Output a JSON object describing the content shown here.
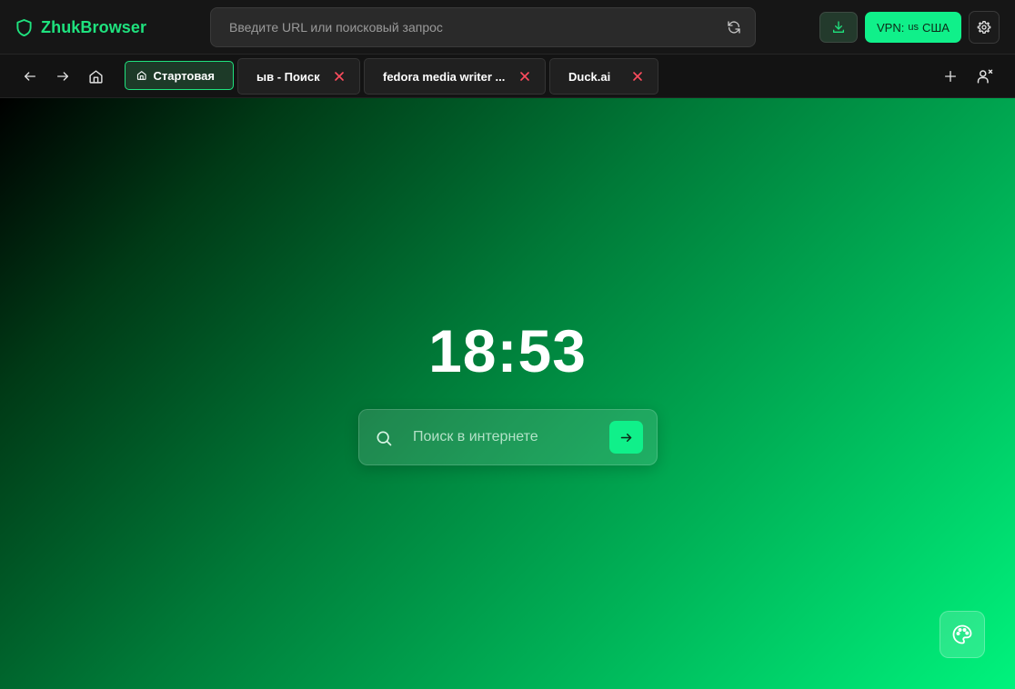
{
  "app": {
    "name": "ZhukBrowser",
    "accent_color": "#1fe27e",
    "logo_icon": "shield-icon"
  },
  "toolbar": {
    "url_placeholder": "Введите URL или поисковый запрос",
    "url_value": "",
    "reload_icon": "refresh-icon",
    "download_icon": "download-icon",
    "vpn": {
      "label": "VPN:",
      "country_code": "us",
      "country_name": "США",
      "color": "#10f08a"
    },
    "settings_icon": "gear-icon"
  },
  "nav": {
    "back_icon": "arrow-left-icon",
    "forward_icon": "arrow-right-icon",
    "home_icon": "home-icon"
  },
  "tabs": [
    {
      "label": "Стартовая",
      "active": true,
      "icon": "home-icon"
    },
    {
      "label": "ыв - Поиск",
      "active": false,
      "close_icon": "close-icon"
    },
    {
      "label": "fedora media writer ...",
      "active": false,
      "close_icon": "close-icon"
    },
    {
      "label": "Duck.ai",
      "active": false,
      "close_icon": "close-icon"
    }
  ],
  "tabbar_actions": {
    "new_tab_icon": "plus-icon",
    "profile_icon": "user-x-icon"
  },
  "start_page": {
    "clock": "18:53",
    "search_placeholder": "Поиск в интернете",
    "search_value": "",
    "search_icon": "search-icon",
    "submit_icon": "arrow-right-icon",
    "theme_icon": "palette-icon",
    "gradient": [
      "#000000",
      "#00f37d"
    ]
  }
}
